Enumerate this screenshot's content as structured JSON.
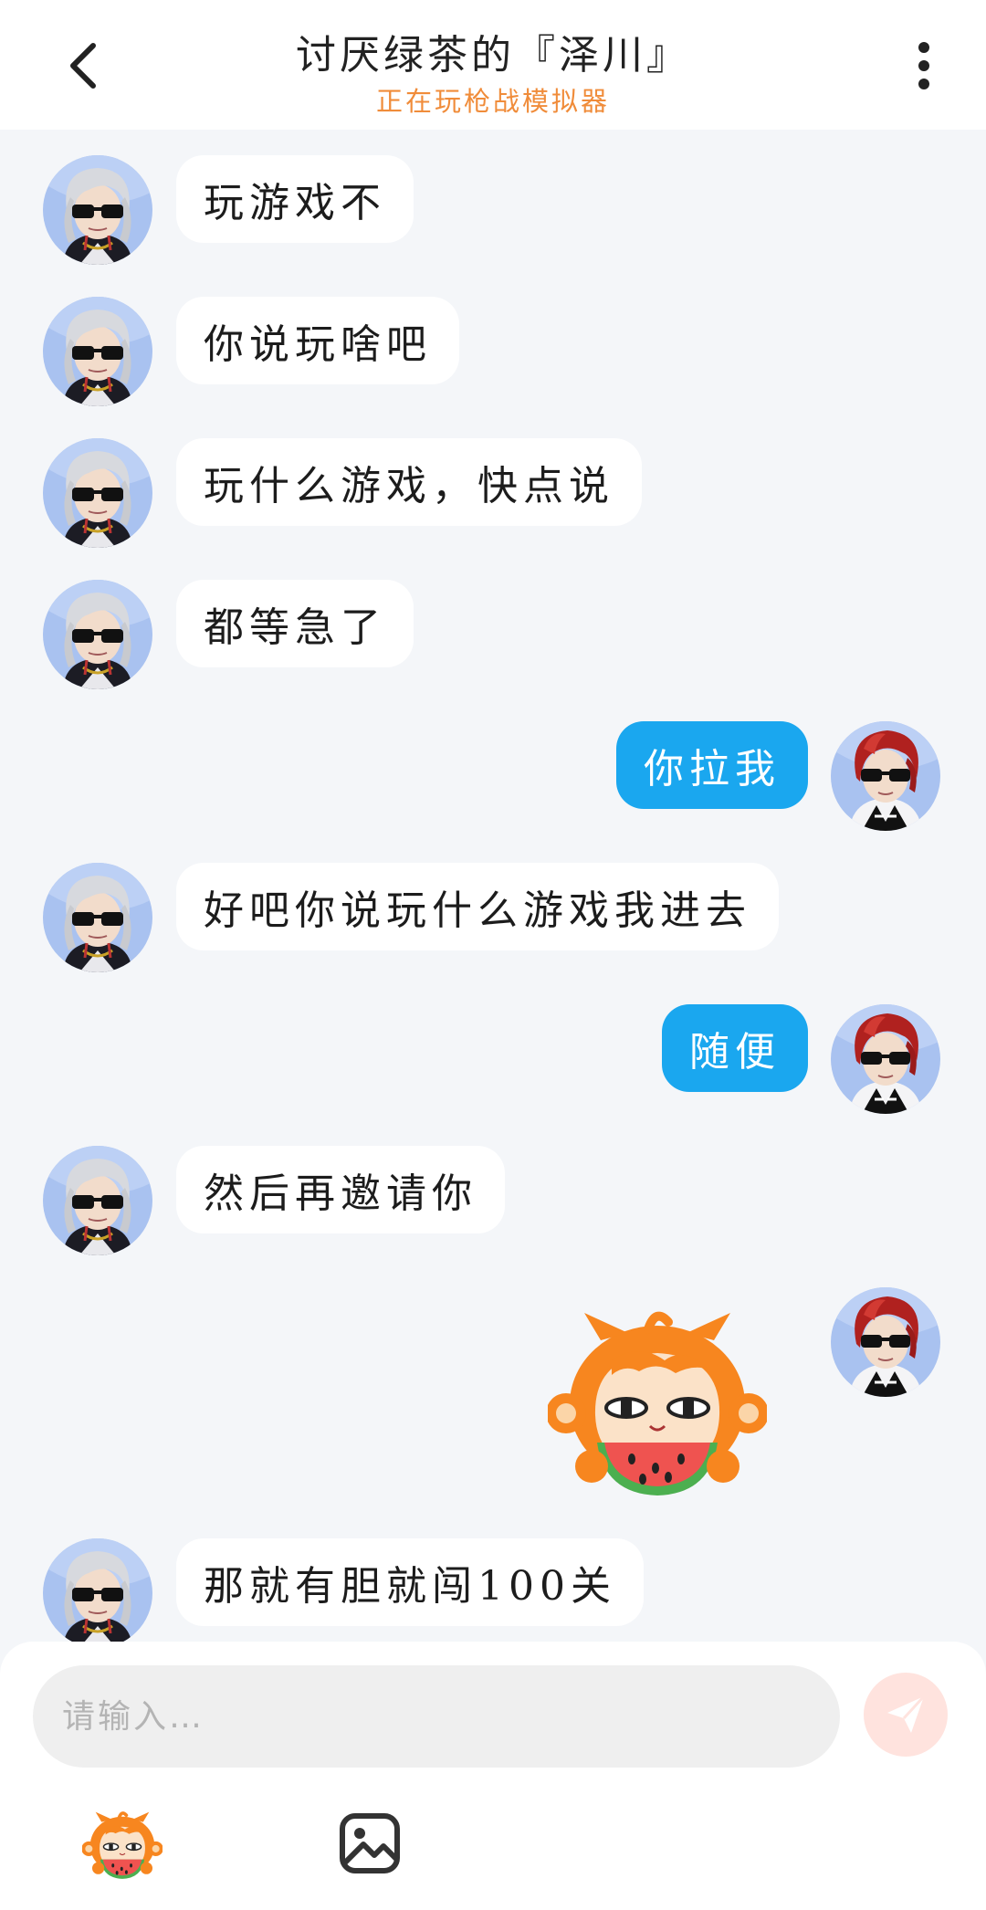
{
  "header": {
    "title": "讨厌绿茶的『泽川』",
    "status": "正在玩枪战模拟器",
    "back_icon": "chevron-left-icon",
    "more_icon": "more-vertical-icon"
  },
  "messages": [
    {
      "side": "in",
      "text": "玩游戏不"
    },
    {
      "side": "in",
      "text": "你说玩啥吧"
    },
    {
      "side": "in",
      "text": "玩什么游戏，快点说"
    },
    {
      "side": "in",
      "text": "都等急了"
    },
    {
      "side": "out",
      "text": "你拉我"
    },
    {
      "side": "in",
      "text": "好吧你说玩什么游戏我进去"
    },
    {
      "side": "out",
      "text": "随便"
    },
    {
      "side": "in",
      "text": "然后再邀请你"
    },
    {
      "side": "out",
      "sticker": "monkey-eating-watermelon-sticker"
    },
    {
      "side": "in",
      "text": "那就有胆就闯100关"
    }
  ],
  "composer": {
    "placeholder": "请输入…",
    "send_icon": "send-paper-plane-icon",
    "emoji_icon": "monkey-emoji-icon",
    "image_icon": "image-gallery-icon"
  },
  "colors": {
    "outgoing_bubble": "#1aa7ef",
    "incoming_bubble": "#ffffff",
    "status_text": "#f08c3a",
    "background": "#f4f6f9",
    "send_button": "#ffe3de"
  }
}
